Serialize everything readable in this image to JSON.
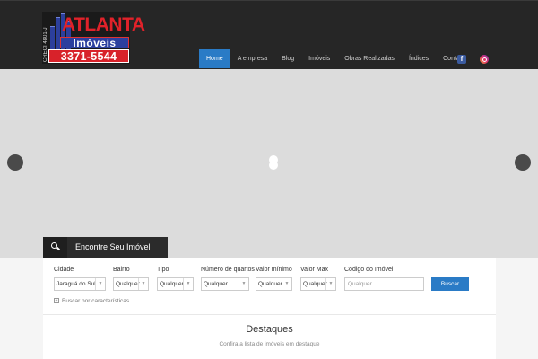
{
  "logo": {
    "name": "ATLANTA",
    "sub": "Imóveis",
    "phone": "3371-5544",
    "creci": "CRECI 4801-J"
  },
  "nav": {
    "items": [
      "Home",
      "A empresa",
      "Blog",
      "Imóveis",
      "Obras Realizadas",
      "Índices",
      "Contato"
    ],
    "active": "Home",
    "facebook_icon": "f"
  },
  "search": {
    "tab_label": "Encontre Seu Imóvel",
    "fields": {
      "cidade": {
        "label": "Cidade",
        "value": "Jaraguá do Sul"
      },
      "bairro": {
        "label": "Bairro",
        "value": "Qualquer"
      },
      "tipo": {
        "label": "Tipo",
        "value": "Qualquer"
      },
      "quartos": {
        "label": "Número de quartos",
        "value": "Qualquer"
      },
      "valor_min": {
        "label": "Valor mínimo",
        "value": "Qualquer"
      },
      "valor_max": {
        "label": "Valor Max",
        "value": "Qualquer"
      },
      "codigo": {
        "label": "Código do Imóvel",
        "placeholder": "Qualquer"
      }
    },
    "button": "Buscar",
    "advanced": "Buscar por características"
  },
  "destaques": {
    "title": "Destaques",
    "subtitle": "Confira a lista de imóveis em destaque"
  },
  "colors": {
    "header_bg": "#262626",
    "accent": "#2a7bc6",
    "slider_bg": "#dcdcdc"
  }
}
